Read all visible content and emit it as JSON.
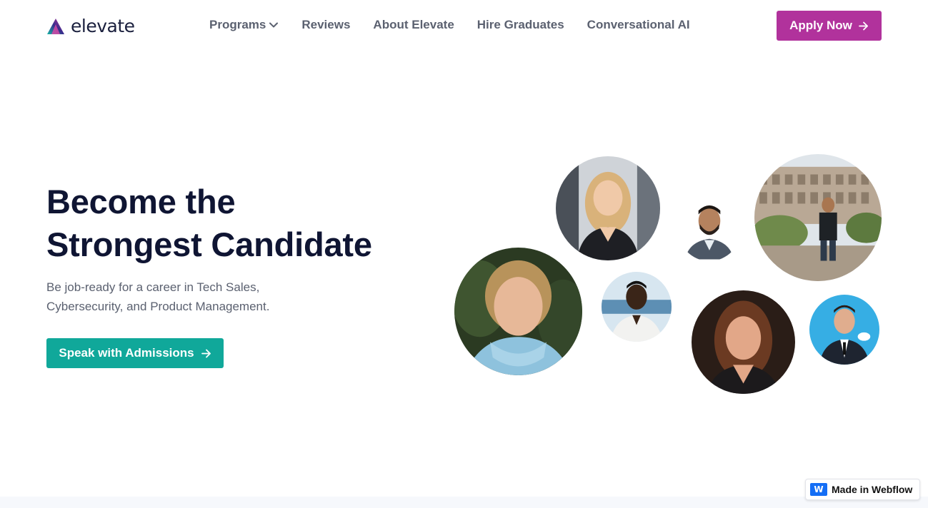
{
  "brand": {
    "name": "elevate",
    "accent": "#b1329c",
    "teal": "#10a89a"
  },
  "nav": {
    "items": [
      {
        "label": "Programs",
        "has_dropdown": true
      },
      {
        "label": "Reviews"
      },
      {
        "label": "About Elevate"
      },
      {
        "label": "Hire Graduates"
      },
      {
        "label": "Conversational AI"
      }
    ],
    "apply_label": "Apply Now"
  },
  "hero": {
    "title_line1": "Become the",
    "title_line2": "Strongest Candidate",
    "subtitle": "Be job-ready for a career in Tech Sales, Cybersecurity, and Product Management.",
    "cta_label": "Speak with Admissions"
  },
  "avatars": [
    {
      "name": "graduate-photo-1",
      "desc": "woman-blonde-blazer"
    },
    {
      "name": "graduate-photo-2",
      "desc": "man-beard-suit"
    },
    {
      "name": "graduate-photo-3",
      "desc": "man-colosseum"
    },
    {
      "name": "graduate-photo-4",
      "desc": "woman-blue-scarf"
    },
    {
      "name": "graduate-photo-5",
      "desc": "man-white-shirt-ocean"
    },
    {
      "name": "graduate-photo-6",
      "desc": "woman-brown-hair"
    },
    {
      "name": "graduate-photo-7",
      "desc": "man-suit-salesforce"
    }
  ],
  "badge": {
    "label": "Made in Webflow"
  }
}
